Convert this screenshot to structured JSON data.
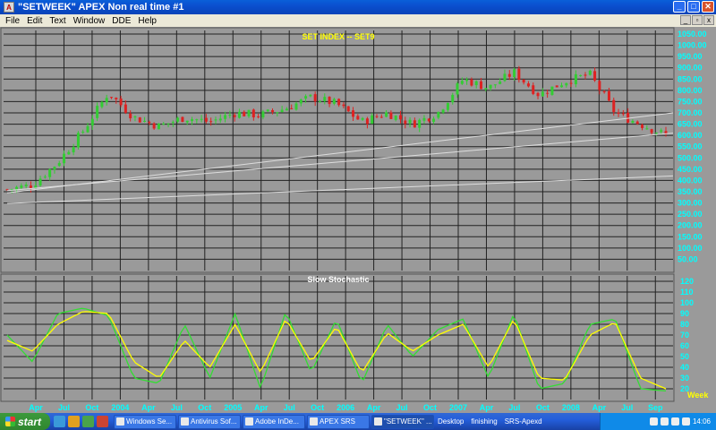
{
  "window": {
    "title": "\"SETWEEK\" APEX Non real time #1",
    "app_icon_letter": "A",
    "minimize": "_",
    "maximize": "□",
    "close": "✕"
  },
  "menu": [
    "File",
    "Edit",
    "Text",
    "Window",
    "DDE",
    "Help"
  ],
  "mdi_controls": [
    "_",
    "▫",
    "x"
  ],
  "upper_panel": {
    "title": "SET INDEX -- SET9",
    "y_labels": [
      "1050.00",
      "1000.00",
      "950.00",
      "900.00",
      "850.00",
      "800.00",
      "750.00",
      "700.00",
      "650.00",
      "600.00",
      "550.00",
      "500.00",
      "450.00",
      "400.00",
      "350.00",
      "300.00",
      "250.00",
      "200.00",
      "150.00",
      "100.00",
      "50.00"
    ]
  },
  "lower_panel": {
    "title": "Slow Stochastic",
    "y_labels": [
      "120",
      "110",
      "100",
      "90",
      "80",
      "70",
      "60",
      "50",
      "40",
      "30",
      "20"
    ]
  },
  "x_axis": {
    "labels": [
      "Apr",
      "Jul",
      "Oct",
      "2004",
      "Apr",
      "Jul",
      "Oct",
      "2005",
      "Apr",
      "Jul",
      "Oct",
      "2006",
      "Apr",
      "Jul",
      "Oct",
      "2007",
      "Apr",
      "Jul",
      "Oct",
      "2008",
      "Apr",
      "Jul",
      "Sep"
    ],
    "period": "Week"
  },
  "colors": {
    "background": "#9a9a9a",
    "grid": "#222222",
    "up_candle": "#33cc33",
    "down_candle": "#dd2222",
    "axis_text": "#00ffff",
    "title_yellow": "#ffff00",
    "stoch_k": "#33dd33",
    "stoch_d": "#ffff00"
  },
  "chart_data": {
    "type": "line",
    "description_price_key": [
      "Apr",
      "Jul",
      "Oct",
      "2004",
      "Apr",
      "Jul",
      "Oct",
      "2005",
      "Apr",
      "Jul",
      "Oct",
      "2006",
      "Apr",
      "Jul",
      "Oct",
      "2007",
      "Apr",
      "Jul",
      "Oct",
      "2008",
      "Apr",
      "Jul",
      "Sep"
    ],
    "series": [
      {
        "values": [
          360,
          380,
          480,
          620,
          790,
          680,
          640,
          680,
          660,
          700,
          690,
          720,
          770,
          740,
          660,
          700,
          650,
          700,
          850,
          810,
          880,
          780,
          840,
          870,
          700,
          650,
          600
        ]
      },
      {
        "values": [
          70,
          45,
          90,
          95,
          88,
          30,
          25,
          80,
          30,
          90,
          20,
          92,
          35,
          85,
          25,
          80,
          50,
          75,
          85,
          30,
          90,
          20,
          25,
          80,
          85,
          20,
          18
        ]
      },
      {
        "values": [
          65,
          55,
          80,
          92,
          90,
          45,
          30,
          65,
          40,
          80,
          35,
          85,
          45,
          78,
          35,
          72,
          55,
          70,
          80,
          40,
          85,
          30,
          28,
          70,
          82,
          30,
          20
        ]
      }
    ],
    "ylim": [
      0,
      1050
    ],
    "ylim_stochastic": [
      0,
      120
    ]
  },
  "taskbar": {
    "start_label": "start",
    "tasks": [
      "Windows Se...",
      "Antivirus Sof...",
      "Adobe InDe...",
      "APEX SRS",
      "\"SETWEEK\" ..."
    ],
    "links": [
      "Desktop",
      "finishing",
      "SRS-Apexd"
    ],
    "clock": "14:06"
  }
}
